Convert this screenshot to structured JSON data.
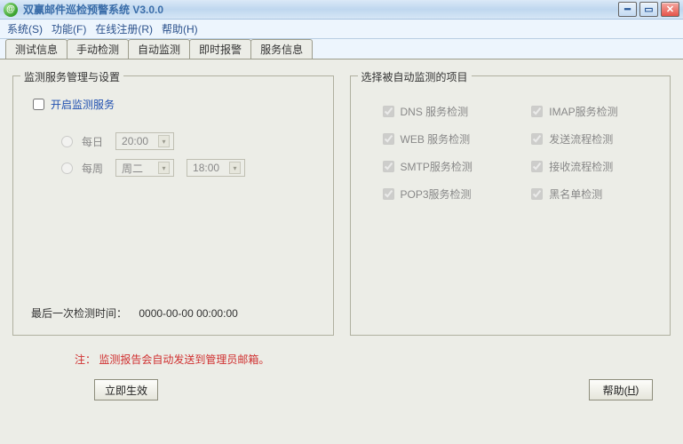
{
  "titlebar": {
    "title": "双赢邮件巡检预警系统  V3.0.0"
  },
  "menus": {
    "system": "系统(S)",
    "function": "功能(F)",
    "register": "在线注册(R)",
    "help": "帮助(H)"
  },
  "tabs": {
    "test": "测试信息",
    "manual": "手动检测",
    "auto": "自动监测",
    "realtime": "即时报警",
    "service": "服务信息"
  },
  "leftGroup": {
    "legend": "监测服务管理与设置",
    "enableLabel": "开启监测服务",
    "daily": "每日",
    "weekly": "每周",
    "timeDaily": "20:00",
    "weekday": "周二",
    "timeWeekly": "18:00",
    "lastLabel": "最后一次检测时间：",
    "lastValue": "0000-00-00 00:00:00"
  },
  "rightGroup": {
    "legend": "选择被自动监测的项目",
    "dns": "DNS 服务检测",
    "imap": "IMAP服务检测",
    "web": "WEB 服务检测",
    "send": "发送流程检测",
    "smtp": "SMTP服务检测",
    "recv": "接收流程检测",
    "pop3": "POP3服务检测",
    "blacklist": "黑名单检测"
  },
  "note": "注： 监测报告会自动发送到管理员邮箱。",
  "buttons": {
    "apply": "立即生效",
    "help": "帮助(",
    "helpU": "H",
    "helpEnd": ")"
  }
}
